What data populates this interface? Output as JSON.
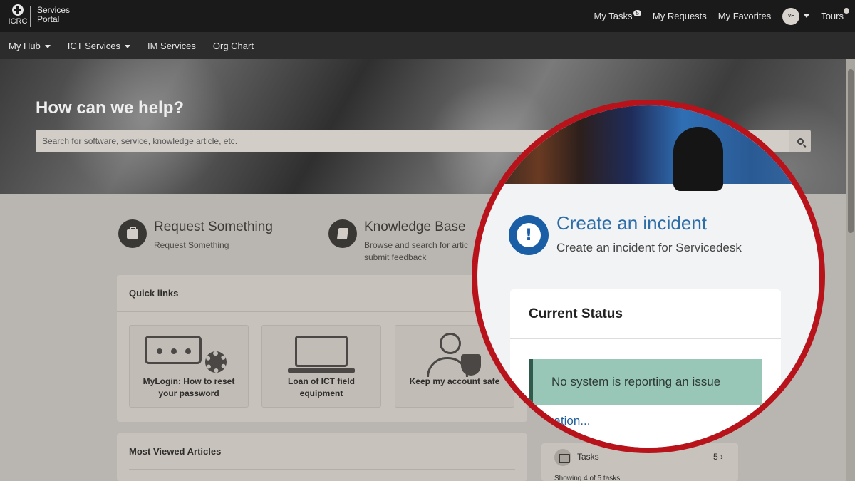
{
  "brand": {
    "logo_text": "ICRC",
    "portal_line1": "Services",
    "portal_line2": "Portal"
  },
  "topnav": {
    "my_tasks": "My Tasks",
    "my_tasks_count": "5",
    "my_requests": "My Requests",
    "my_favorites": "My Favorites",
    "avatar_initials": "VF",
    "tours": "Tours"
  },
  "subnav": {
    "items": [
      "My Hub",
      "ICT Services",
      "IM Services",
      "Org Chart"
    ]
  },
  "hero": {
    "title": "How can we help?",
    "search_placeholder": "Search for software, service, knowledge article, etc."
  },
  "actions": {
    "request": {
      "title": "Request Something",
      "subtitle": "Request Something"
    },
    "knowledge": {
      "title": "Knowledge Base",
      "subtitle_line1": "Browse and search for artic",
      "subtitle_line2": "submit feedback"
    }
  },
  "quick_links": {
    "title": "Quick links",
    "items": [
      {
        "line1": "MyLogin: How to reset",
        "line2": "your password"
      },
      {
        "line1": "Loan of ICT field",
        "line2": "equipment"
      },
      {
        "line1": "Keep my account safe",
        "line2": ""
      }
    ]
  },
  "most_viewed": {
    "title": "Most Viewed Articles"
  },
  "tasks": {
    "label": "Tasks",
    "count": "5 ›",
    "showing": "Showing 4 of 5 tasks"
  },
  "zoom": {
    "incident_title": "Create an incident",
    "incident_subtitle": "Create an incident for Servicedesk",
    "status_title": "Current Status",
    "status_message": "No system is reporting an issue",
    "more_info": "e information..."
  },
  "colors": {
    "accent_red": "#b8121b",
    "incident_blue": "#1a5ea6",
    "status_green": "#99c7b7"
  }
}
